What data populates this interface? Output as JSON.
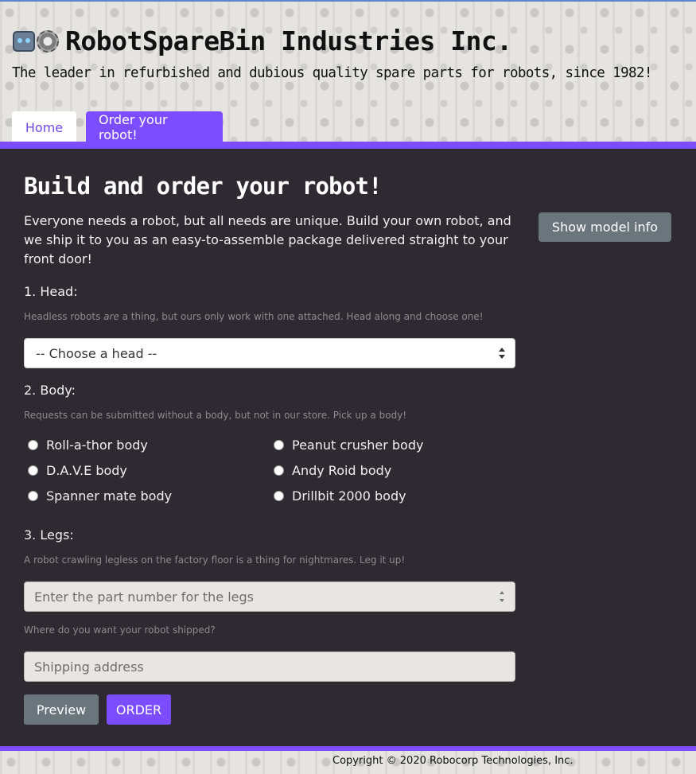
{
  "header": {
    "title": "RobotSpareBin Industries Inc.",
    "tagline": "The leader in refurbished and dubious quality spare parts for robots, since 1982!",
    "icons": [
      "robot-icon",
      "gear-icon"
    ]
  },
  "nav": {
    "tabs": [
      {
        "label": "Home",
        "active": false
      },
      {
        "label": "Order your robot!",
        "active": true
      }
    ]
  },
  "main": {
    "title": "Build and order your robot!",
    "intro": "Everyone needs a robot, but all needs are unique. Build your own robot, and we ship it to you as an easy-to-assemble package delivered straight to your front door!",
    "model_info_button": "Show model info",
    "head": {
      "label": "1. Head:",
      "help_before": "Headless robots ",
      "help_em": "are",
      "help_after": " a thing, but ours only work with one attached. Head along and choose one!",
      "select_value": "-- Choose a head --"
    },
    "body": {
      "label": "2. Body:",
      "help": "Requests can be submitted without a body, but not in our store. Pick up a body!",
      "options": [
        "Roll-a-thor body",
        "Peanut crusher body",
        "D.A.V.E body",
        "Andy Roid body",
        "Spanner mate body",
        "Drillbit 2000 body"
      ]
    },
    "legs": {
      "label": "3. Legs:",
      "help": "A robot crawling legless on the factory floor is a thing for nightmares. Leg it up!",
      "placeholder": "Enter the part number for the legs"
    },
    "shipping": {
      "help": "Where do you want your robot shipped?",
      "placeholder": "Shipping address"
    },
    "buttons": {
      "preview": "Preview",
      "order": "ORDER"
    }
  },
  "footer": {
    "copyright": "Copyright © 2020 Robocorp Technologies, Inc."
  },
  "colors": {
    "accent": "#7c4dff",
    "background": "#2f2a31",
    "secondary_button": "#6b757c"
  }
}
